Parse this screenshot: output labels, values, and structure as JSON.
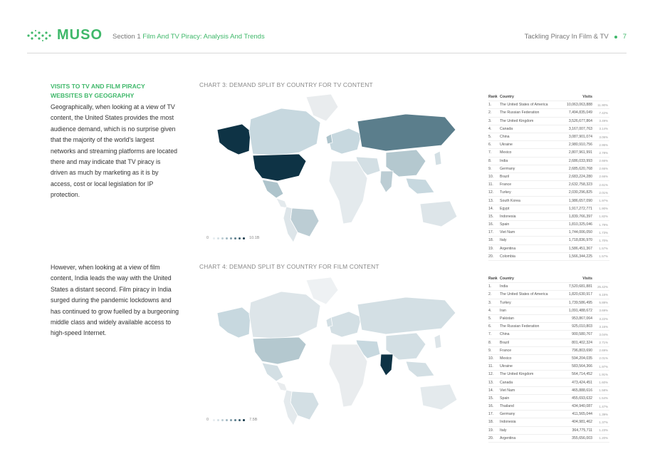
{
  "header": {
    "logo_text": "MUSO",
    "section_prefix": "Section 1",
    "section_title": "Film And TV Piracy: Analysis And Trends",
    "report_title": "Tackling Piracy In Film & TV",
    "page_number": "7"
  },
  "subhead": "VISITS TO TV AND FILM PIRACY WEBSITES BY GEOGRAPHY",
  "paragraph1": "Geographically, when looking at a view of TV content, the United States provides the most audience demand, which is no surprise given that the majority of the world's largest networks and streaming platforms are located there and may indicate that TV piracy is driven as much by marketing as it is by access, cost or local legislation for IP protection.",
  "paragraph2": "However, when looking at a view of film content, India leads the way with the United States a distant second. Film piracy in India surged during the pandemic lockdowns and has continued to grow fuelled by a burgeoning middle class and widely available access to high-speed Internet.",
  "colors": {
    "brand_green": "#3fb86a",
    "map_dark": "#0e3345",
    "map_mid": "#5b7e8c",
    "map_light": "#c7d8df",
    "map_base": "#e9ecee"
  },
  "charts": [
    {
      "title": "CHART 3: DEMAND SPLIT BY COUNTRY FOR TV CONTENT",
      "legend_min": "0",
      "legend_max": "10.1B",
      "table_headers": {
        "rank": "Rank",
        "country": "Country",
        "visits": "Visits"
      },
      "rows": [
        {
          "rank": "1.",
          "country": "The United States of America",
          "visits": "10,063,063,888",
          "pct": "11.90%"
        },
        {
          "rank": "2.",
          "country": "The Russian Federation",
          "visits": "7,494,835,049",
          "pct": "7.42%"
        },
        {
          "rank": "3.",
          "country": "The United Kingdom",
          "visits": "3,526,677,864",
          "pct": "3.49%"
        },
        {
          "rank": "4.",
          "country": "Canada",
          "visits": "3,167,007,763",
          "pct": "3.14%"
        },
        {
          "rank": "5.",
          "country": "China",
          "visits": "3,087,901,074",
          "pct": "3.06%"
        },
        {
          "rank": "6.",
          "country": "Ukraine",
          "visits": "2,980,910,756",
          "pct": "2.95%"
        },
        {
          "rank": "7.",
          "country": "Mexico",
          "visits": "2,807,961,991",
          "pct": "2.78%"
        },
        {
          "rank": "8.",
          "country": "India",
          "visits": "2,686,033,993",
          "pct": "2.66%"
        },
        {
          "rank": "9.",
          "country": "Germany",
          "visits": "2,685,620,768",
          "pct": "2.66%"
        },
        {
          "rank": "10.",
          "country": "Brazil",
          "visits": "2,683,224,280",
          "pct": "2.66%"
        },
        {
          "rank": "11.",
          "country": "France",
          "visits": "2,632,758,323",
          "pct": "2.61%"
        },
        {
          "rank": "12.",
          "country": "Turkey",
          "visits": "2,030,296,825",
          "pct": "2.01%"
        },
        {
          "rank": "13.",
          "country": "South Korea",
          "visits": "1,986,657,090",
          "pct": "1.97%"
        },
        {
          "rank": "14.",
          "country": "Egypt",
          "visits": "1,917,272,771",
          "pct": "1.90%"
        },
        {
          "rank": "15.",
          "country": "Indonesia",
          "visits": "1,839,766,397",
          "pct": "1.82%"
        },
        {
          "rank": "16.",
          "country": "Spain",
          "visits": "1,810,325,046",
          "pct": "1.79%"
        },
        {
          "rank": "17.",
          "country": "Viet Nam",
          "visits": "1,744,006,050",
          "pct": "1.73%"
        },
        {
          "rank": "18.",
          "country": "Italy",
          "visits": "1,718,836,970",
          "pct": "1.70%"
        },
        {
          "rank": "19.",
          "country": "Argentina",
          "visits": "1,586,451,367",
          "pct": "1.57%"
        },
        {
          "rank": "20.",
          "country": "Colombia",
          "visits": "1,566,344,225",
          "pct": "1.57%"
        }
      ]
    },
    {
      "title": "CHART 4: DEMAND SPLIT BY COUNTRY FOR FILM CONTENT",
      "legend_min": "0",
      "legend_max": "7.5B",
      "table_headers": {
        "rank": "Rank",
        "country": "Country",
        "visits": "Visits"
      },
      "rows": [
        {
          "rank": "1.",
          "country": "India",
          "visits": "7,520,681,881",
          "pct": "25.42%"
        },
        {
          "rank": "2.",
          "country": "The United States of America",
          "visits": "1,820,630,917",
          "pct": "6.15%"
        },
        {
          "rank": "3.",
          "country": "Turkey",
          "visits": "1,739,586,495",
          "pct": "5.88%"
        },
        {
          "rank": "4.",
          "country": "Iran",
          "visits": "1,091,488,672",
          "pct": "3.69%"
        },
        {
          "rank": "5.",
          "country": "Pakistan",
          "visits": "953,867,064",
          "pct": "3.22%"
        },
        {
          "rank": "6.",
          "country": "The Russian Federation",
          "visits": "925,010,803",
          "pct": "3.16%"
        },
        {
          "rank": "7.",
          "country": "China",
          "visits": "900,580,767",
          "pct": "3.04%"
        },
        {
          "rank": "8.",
          "country": "Brazil",
          "visits": "801,402,324",
          "pct": "2.71%"
        },
        {
          "rank": "9.",
          "country": "France",
          "visits": "796,803,690",
          "pct": "2.69%"
        },
        {
          "rank": "10.",
          "country": "Mexico",
          "visits": "594,204,035",
          "pct": "2.01%"
        },
        {
          "rank": "11.",
          "country": "Ukraine",
          "visits": "583,564,366",
          "pct": "1.97%"
        },
        {
          "rank": "12.",
          "country": "The United Kingdom",
          "visits": "564,714,452",
          "pct": "1.91%"
        },
        {
          "rank": "13.",
          "country": "Canada",
          "visits": "473,424,451",
          "pct": "1.60%"
        },
        {
          "rank": "14.",
          "country": "Viet Nam",
          "visits": "465,888,616",
          "pct": "1.58%"
        },
        {
          "rank": "15.",
          "country": "Spain",
          "visits": "455,693,632",
          "pct": "1.54%"
        },
        {
          "rank": "16.",
          "country": "Thailand",
          "visits": "434,940,087",
          "pct": "1.47%"
        },
        {
          "rank": "17.",
          "country": "Germany",
          "visits": "411,565,044",
          "pct": "1.39%"
        },
        {
          "rank": "18.",
          "country": "Indonesia",
          "visits": "404,981,462",
          "pct": "1.37%"
        },
        {
          "rank": "19.",
          "country": "Italy",
          "visits": "364,775,711",
          "pct": "1.23%"
        },
        {
          "rank": "20.",
          "country": "Argentina",
          "visits": "355,656,003",
          "pct": "1.20%"
        }
      ]
    }
  ]
}
